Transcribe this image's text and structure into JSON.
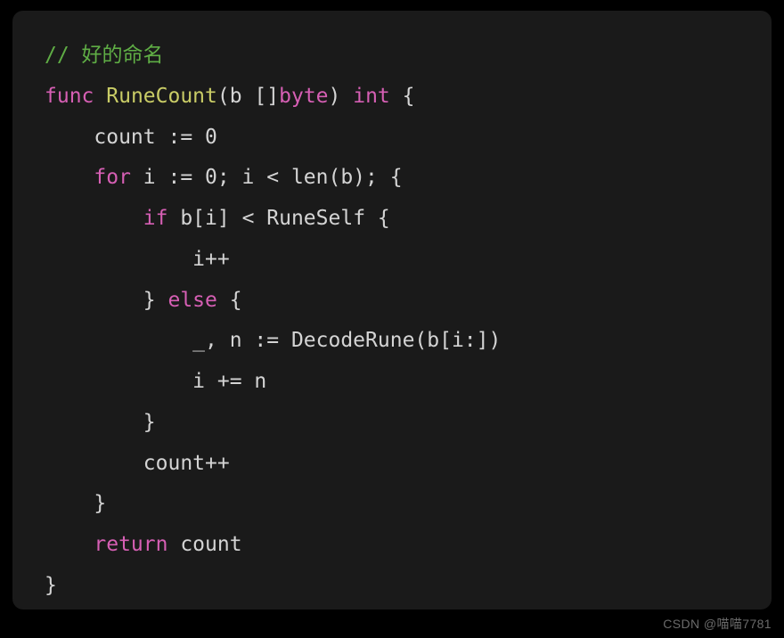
{
  "code": {
    "line1_comment": "// 好的命名",
    "line2_kw_func": "func",
    "line2_name": "RuneCount",
    "line2_sig_open": "(b []",
    "line2_type_byte": "byte",
    "line2_sig_close": ") ",
    "line2_type_int": "int",
    "line2_brace": " {",
    "line3": "    count := 0",
    "line4_indent": "    ",
    "line4_for": "for",
    "line4_rest": " i := 0; i < len(b); {",
    "line5_indent": "        ",
    "line5_if": "if",
    "line5_rest": " b[i] < RuneSelf {",
    "line6": "            i++",
    "line7_indent": "        ",
    "line7_close": "} ",
    "line7_else": "else",
    "line7_open": " {",
    "line8": "            _, n := DecodeRune(b[i:])",
    "line9": "            i += n",
    "line10": "        }",
    "line11": "        count++",
    "line12": "    }",
    "line13_indent": "    ",
    "line13_return": "return",
    "line13_rest": " count",
    "line14": "}"
  },
  "watermark": "CSDN @喵喵7781"
}
